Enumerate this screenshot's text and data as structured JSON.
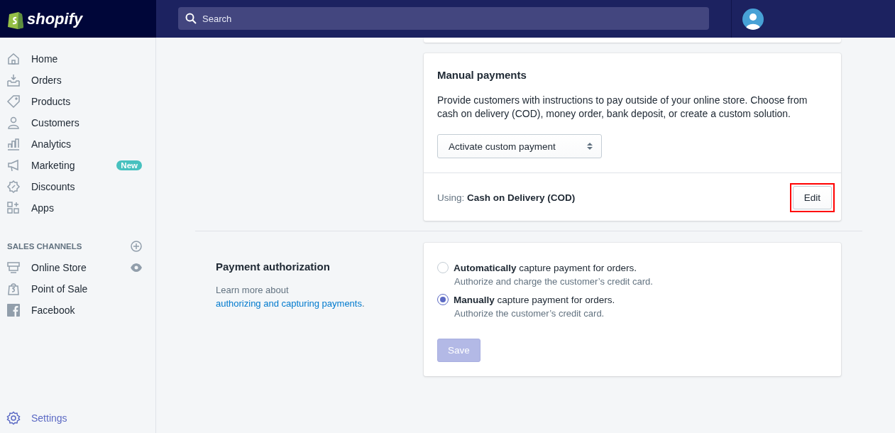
{
  "topbar": {
    "logo": "shopify",
    "search": {
      "placeholder": "Search"
    }
  },
  "sidebar": {
    "items": [
      {
        "label": "Home",
        "selected": false
      },
      {
        "label": "Orders",
        "selected": false
      },
      {
        "label": "Products",
        "selected": false
      },
      {
        "label": "Customers",
        "selected": false
      },
      {
        "label": "Analytics",
        "selected": false
      },
      {
        "label": "Marketing",
        "selected": false,
        "badge": "New"
      },
      {
        "label": "Discounts",
        "selected": false
      },
      {
        "label": "Apps",
        "selected": false
      }
    ],
    "sales_channels": {
      "heading": "SALES CHANNELS",
      "items": [
        {
          "label": "Online Store",
          "selected": false
        },
        {
          "label": "Point of Sale",
          "selected": false
        },
        {
          "label": "Facebook",
          "selected": false
        }
      ]
    },
    "settings": {
      "label": "Settings",
      "selected": true
    }
  },
  "manual_payments": {
    "title": "Manual payments",
    "description": "Provide customers with instructions to pay outside of your online store. Choose from cash on delivery (COD), money order, bank deposit, or create a custom solution.",
    "select": "Activate custom payment",
    "using": "Using: **Cash on Delivery (COD)**",
    "edit_button": {
      "label": "Edit",
      "highlighted": true
    }
  },
  "payment_authorization": {
    "title": "Payment authorization",
    "help_text": "Learn more about",
    "help_link": "authorizing and capturing payments",
    "help_end": ".",
    "options": [
      {
        "label": "**Automatically** capture payment for orders.",
        "hint": "Authorize and charge the customer’s credit card.",
        "selected": false
      },
      {
        "label": "**Manually** capture payment for orders.",
        "hint": "Authorize the customer’s credit card.",
        "selected": true
      }
    ],
    "save_button": {
      "label": "Save",
      "disabled": true
    }
  }
}
